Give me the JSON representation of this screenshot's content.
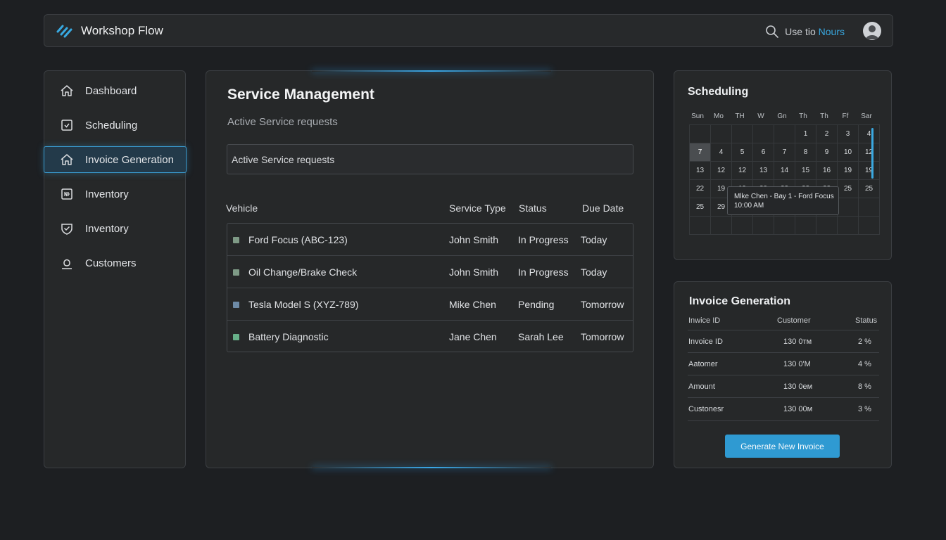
{
  "app": {
    "name": "Workshop Flow",
    "search_prefix": "Use tio",
    "search_accent": "Nours"
  },
  "colors": {
    "accent": "#38a8e0",
    "background": "#1d1f22",
    "panel": "#262829",
    "button": "#2f9ad2"
  },
  "sidebar": {
    "items": [
      {
        "label": "Dashboard",
        "icon": "home-icon"
      },
      {
        "label": "Scheduling",
        "icon": "calendar-check-icon"
      },
      {
        "label": "Invoice Generation",
        "icon": "home-icon",
        "active": true
      },
      {
        "label": "Inventory",
        "icon": "box-icon"
      },
      {
        "label": "Inventory",
        "icon": "shield-check-icon"
      },
      {
        "label": "Customers",
        "icon": "user-icon"
      }
    ]
  },
  "main": {
    "title": "Service Management",
    "subtitle": "Active Service requests",
    "search_placeholder": "Active Service requests",
    "columns": [
      "Vehicle",
      "Service Type",
      "Status",
      "Due Date"
    ],
    "rows": [
      {
        "vehicle": "Ford Focus (ABC-123)",
        "service": "John Smith",
        "status": "In Progress",
        "due": "Today",
        "color": "#7e9a86"
      },
      {
        "vehicle": "Oil Change/Brake Check",
        "service": "John Smith",
        "status": "In Progress",
        "due": "Today",
        "color": "#7e9a86"
      },
      {
        "vehicle": "Tesla Model S (XYZ-789)",
        "service": "Mike Chen",
        "status": "Pending",
        "due": "Tomorrow",
        "color": "#6d8aa6"
      },
      {
        "vehicle": "Battery Diagnostic",
        "service": "Jane Chen",
        "status": "Sarah Lee",
        "due": "Tomorrow",
        "color": "#67b089"
      }
    ]
  },
  "scheduling": {
    "title": "Scheduling",
    "days": [
      "Sun",
      "Mo",
      "TH",
      "W",
      "Gn",
      "Th",
      "Th",
      "Ff",
      "Sar"
    ],
    "weeks": [
      [
        "",
        "",
        "",
        "",
        "",
        "1",
        "2",
        "3",
        "4"
      ],
      [
        "7",
        "4",
        "5",
        "6",
        "7",
        "8",
        "9",
        "10",
        "12"
      ],
      [
        "13",
        "12",
        "12",
        "13",
        "14",
        "15",
        "16",
        "19",
        "19"
      ],
      [
        "22",
        "19",
        "19",
        "20",
        "22",
        "23",
        "23",
        "25",
        "25"
      ],
      [
        "25",
        "29",
        "",
        "",
        "",
        "",
        "",
        "",
        ""
      ],
      [
        "",
        "",
        "",
        "",
        "",
        "",
        "",
        "",
        ""
      ]
    ],
    "selected": "7",
    "event_line1": "Mlke Chen - Bay 1 - Ford Focus",
    "event_line2": "10:00 AM"
  },
  "invoice": {
    "title": "Invoice Generation",
    "columns": [
      "Inwice ID",
      "Customer",
      "Status"
    ],
    "rows": [
      {
        "label": "Invoice ID",
        "time": "130 0тм",
        "status": "2 %"
      },
      {
        "label": "Aatomer",
        "time": "130 0'M",
        "status": "4 %"
      },
      {
        "label": "Amount",
        "time": "130 0eм",
        "status": "8 %"
      },
      {
        "label": "Custonesr",
        "time": "130 00м",
        "status": "3 %"
      }
    ],
    "button": "Generate New Invoice"
  }
}
